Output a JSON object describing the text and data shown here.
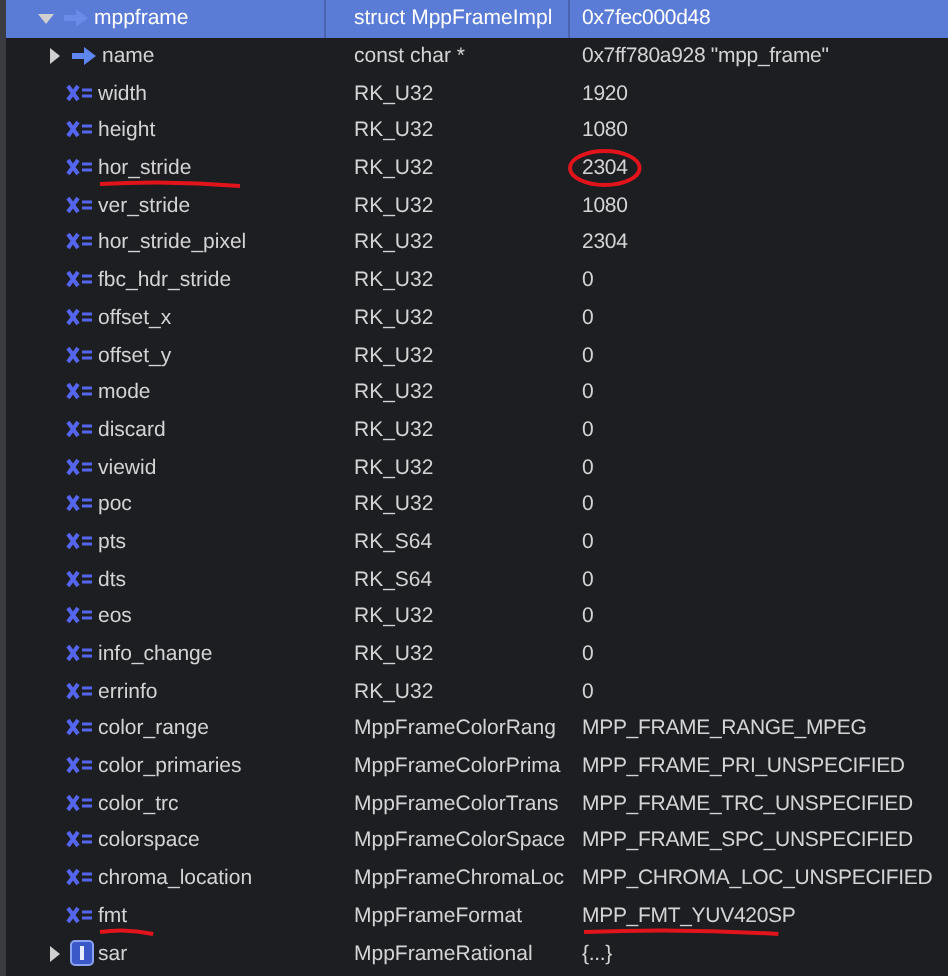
{
  "rows": [
    {
      "kind": "struct",
      "name": "mppframe",
      "type": "struct MppFrameImpl",
      "value": "0x7fec000d48",
      "expanded": true,
      "selected": true
    },
    {
      "kind": "pointer",
      "name": "name",
      "type": "const char *",
      "value": "0x7ff780a928 \"mpp_frame\"",
      "expanded": false,
      "selected": false
    },
    {
      "kind": "field",
      "name": "width",
      "type": "RK_U32",
      "value": "1920",
      "selected": false
    },
    {
      "kind": "field",
      "name": "height",
      "type": "RK_U32",
      "value": "1080",
      "selected": false
    },
    {
      "kind": "field",
      "name": "hor_stride",
      "type": "RK_U32",
      "value": "2304",
      "selected": false,
      "name_underlined": true,
      "value_underlined": false,
      "value_circled": true
    },
    {
      "kind": "field",
      "name": "ver_stride",
      "type": "RK_U32",
      "value": "1080",
      "selected": false
    },
    {
      "kind": "field",
      "name": "hor_stride_pixel",
      "type": "RK_U32",
      "value": "2304",
      "selected": false
    },
    {
      "kind": "field",
      "name": "fbc_hdr_stride",
      "type": "RK_U32",
      "value": "0",
      "selected": false
    },
    {
      "kind": "field",
      "name": "offset_x",
      "type": "RK_U32",
      "value": "0",
      "selected": false
    },
    {
      "kind": "field",
      "name": "offset_y",
      "type": "RK_U32",
      "value": "0",
      "selected": false
    },
    {
      "kind": "field",
      "name": "mode",
      "type": "RK_U32",
      "value": "0",
      "selected": false
    },
    {
      "kind": "field",
      "name": "discard",
      "type": "RK_U32",
      "value": "0",
      "selected": false
    },
    {
      "kind": "field",
      "name": "viewid",
      "type": "RK_U32",
      "value": "0",
      "selected": false
    },
    {
      "kind": "field",
      "name": "poc",
      "type": "RK_U32",
      "value": "0",
      "selected": false
    },
    {
      "kind": "field",
      "name": "pts",
      "type": "RK_S64",
      "value": "0",
      "selected": false
    },
    {
      "kind": "field",
      "name": "dts",
      "type": "RK_S64",
      "value": "0",
      "selected": false
    },
    {
      "kind": "field",
      "name": "eos",
      "type": "RK_U32",
      "value": "0",
      "selected": false
    },
    {
      "kind": "field",
      "name": "info_change",
      "type": "RK_U32",
      "value": "0",
      "selected": false
    },
    {
      "kind": "field",
      "name": "errinfo",
      "type": "RK_U32",
      "value": "0",
      "selected": false
    },
    {
      "kind": "field",
      "name": "color_range",
      "type": "MppFrameColorRang",
      "value": "MPP_FRAME_RANGE_MPEG",
      "selected": false
    },
    {
      "kind": "field",
      "name": "color_primaries",
      "type": "MppFrameColorPrima",
      "value": "MPP_FRAME_PRI_UNSPECIFIED",
      "selected": false
    },
    {
      "kind": "field",
      "name": "color_trc",
      "type": "MppFrameColorTrans",
      "value": "MPP_FRAME_TRC_UNSPECIFIED",
      "selected": false
    },
    {
      "kind": "field",
      "name": "colorspace",
      "type": "MppFrameColorSpace",
      "value": "MPP_FRAME_SPC_UNSPECIFIED",
      "selected": false
    },
    {
      "kind": "field",
      "name": "chroma_location",
      "type": "MppFrameChromaLoc",
      "value": "MPP_CHROMA_LOC_UNSPECIFIED",
      "selected": false
    },
    {
      "kind": "field",
      "name": "fmt",
      "type": "MppFrameFormat",
      "value": "MPP_FMT_YUV420SP",
      "selected": false,
      "name_underlined": true,
      "value_underlined": true,
      "value_circled": false
    },
    {
      "kind": "member",
      "name": "sar",
      "type": "MppFrameRational",
      "value": "{...}",
      "expanded": false,
      "selected": false
    }
  ]
}
